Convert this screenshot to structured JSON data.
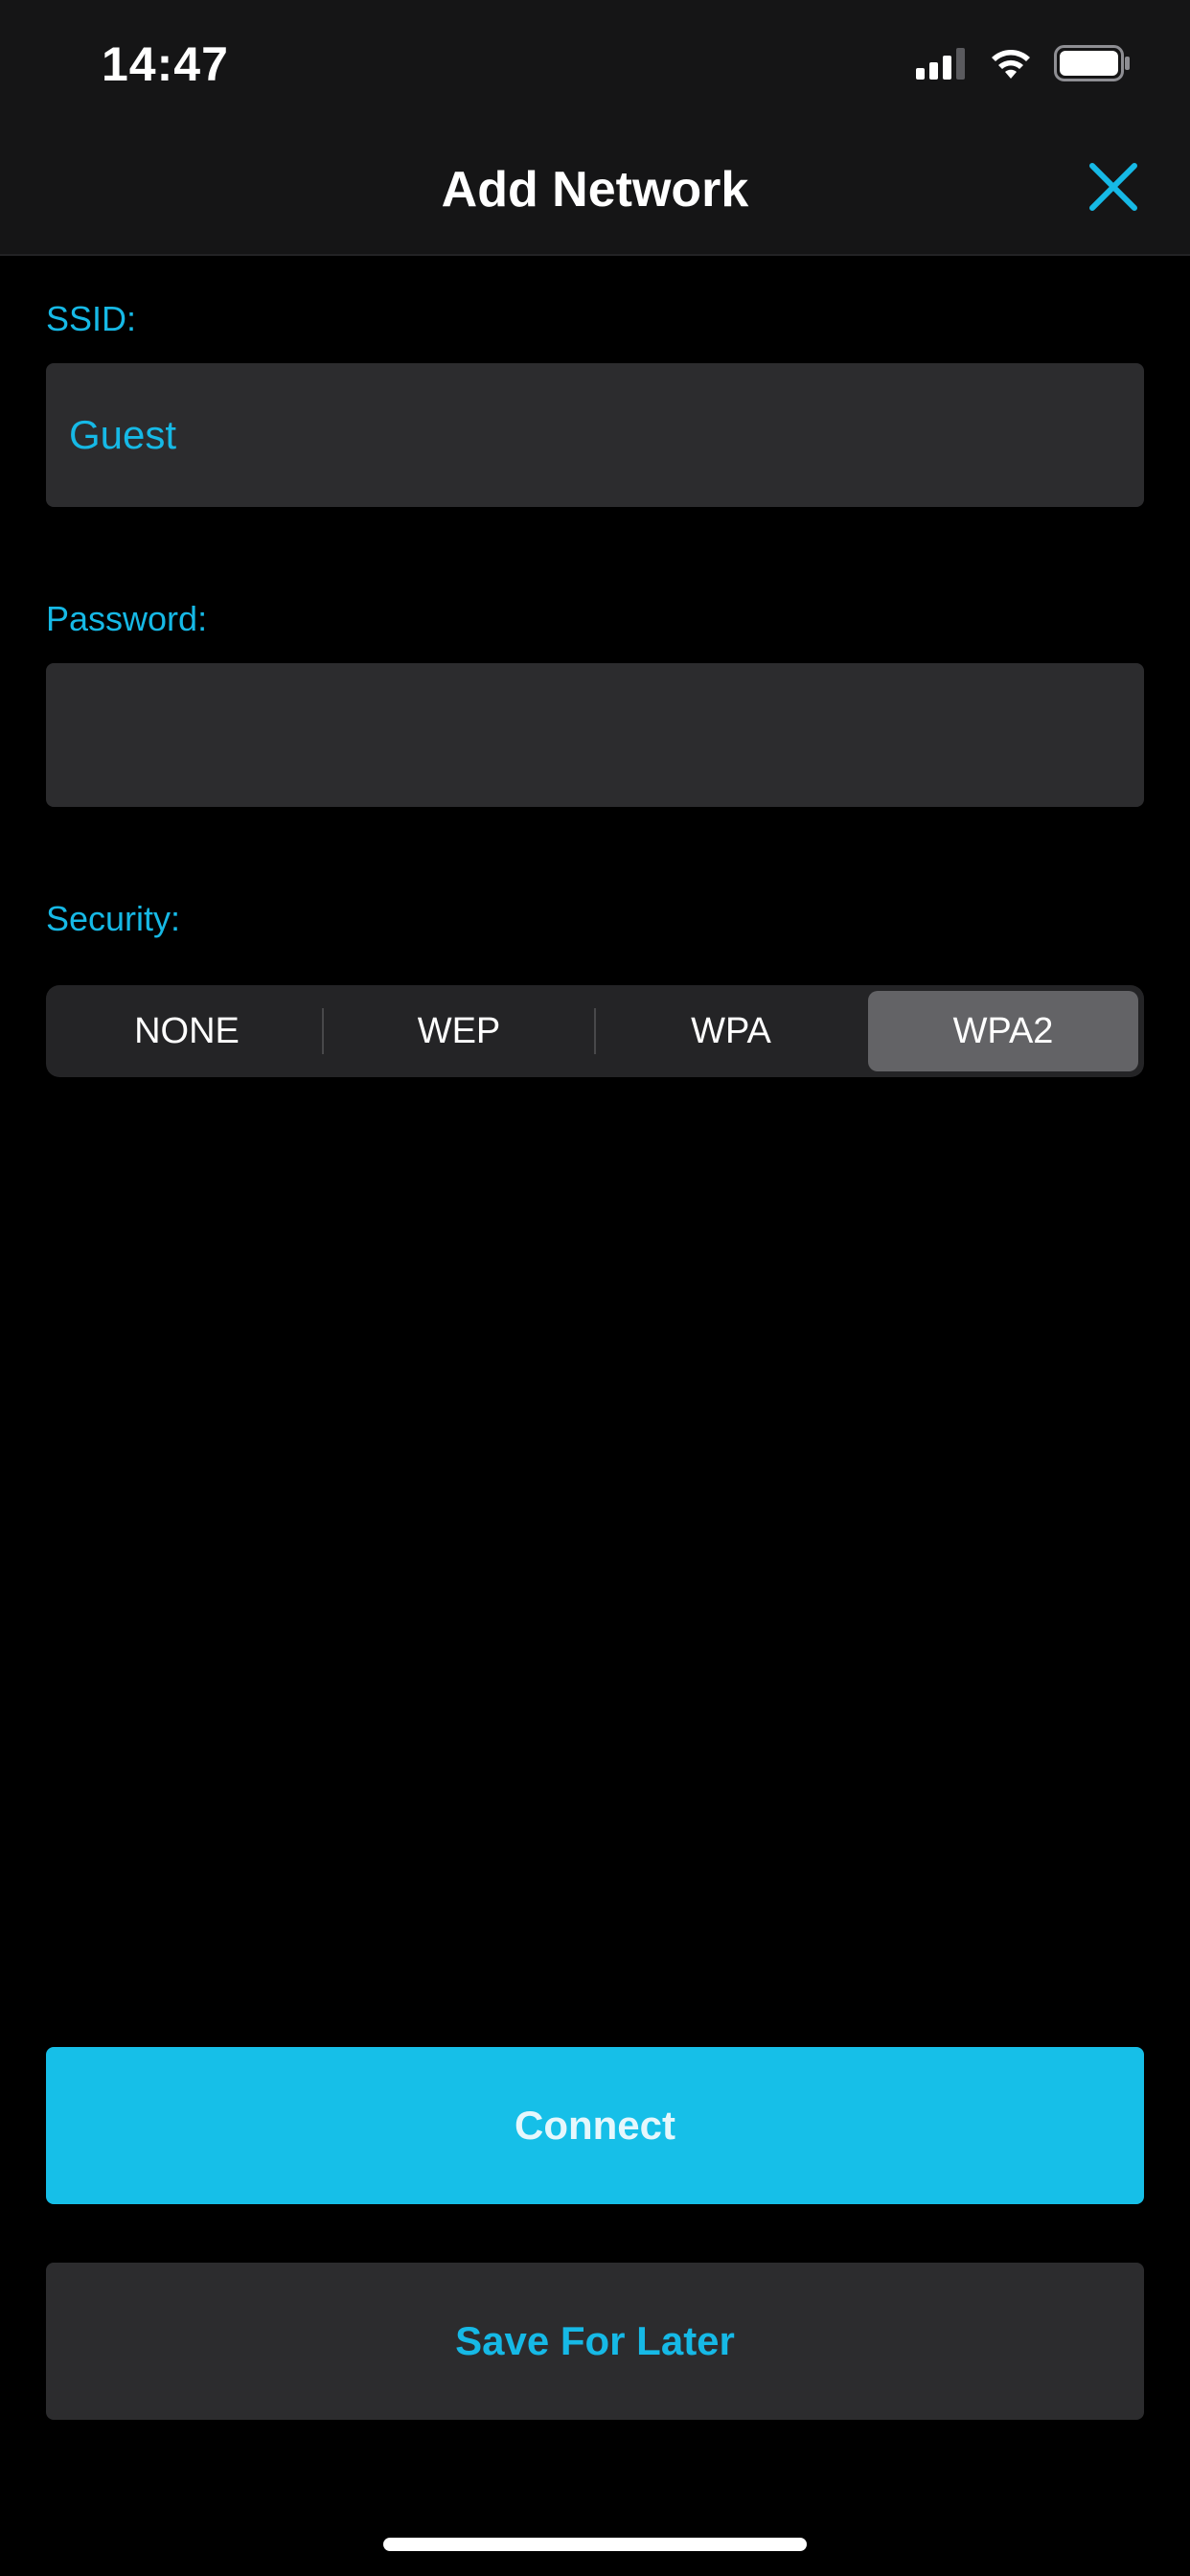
{
  "status_bar": {
    "time": "14:47",
    "icons": [
      "cellular-signal-icon",
      "wifi-icon",
      "battery-icon"
    ]
  },
  "nav": {
    "title": "Add Network",
    "close_icon": "close-icon"
  },
  "form": {
    "ssid": {
      "label": "SSID:",
      "value": "Guest"
    },
    "password": {
      "label": "Password:",
      "value": ""
    },
    "security": {
      "label": "Security:",
      "options": [
        "NONE",
        "WEP",
        "WPA",
        "WPA2"
      ],
      "selected": "WPA2"
    }
  },
  "actions": {
    "connect_label": "Connect",
    "save_label": "Save For Later"
  },
  "colors": {
    "accent": "#16b9e6",
    "button_primary": "#16bfe8",
    "field_bg": "#2c2c2e",
    "background": "#000000"
  }
}
